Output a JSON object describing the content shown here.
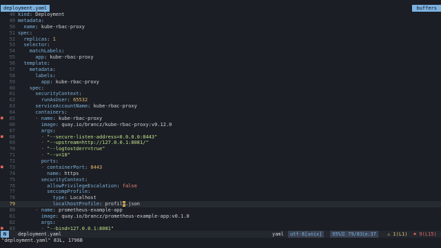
{
  "tabs": {
    "active": "deployment.yaml",
    "right_label": "buffers"
  },
  "lines": [
    {
      "n": "48",
      "sign": "",
      "segs": [
        [
          "k",
          "kind"
        ],
        [
          "v",
          ": Deployment"
        ]
      ]
    },
    {
      "n": "49",
      "sign": "",
      "segs": [
        [
          "k",
          "metadata"
        ],
        [
          "v",
          ":"
        ]
      ]
    },
    {
      "n": "50",
      "sign": "",
      "segs": [
        [
          "v",
          "  "
        ],
        [
          "k",
          "name"
        ],
        [
          "v",
          ": kube-rbac-proxy"
        ]
      ]
    },
    {
      "n": "51",
      "sign": "",
      "segs": [
        [
          "k",
          "spec"
        ],
        [
          "v",
          ":"
        ]
      ]
    },
    {
      "n": "52",
      "sign": "",
      "segs": [
        [
          "v",
          "  "
        ],
        [
          "k",
          "replicas"
        ],
        [
          "v",
          ": "
        ],
        [
          "n",
          "1"
        ]
      ]
    },
    {
      "n": "53",
      "sign": "",
      "segs": [
        [
          "v",
          "  "
        ],
        [
          "k",
          "selector"
        ],
        [
          "v",
          ":"
        ]
      ]
    },
    {
      "n": "54",
      "sign": "",
      "segs": [
        [
          "v",
          "    "
        ],
        [
          "k",
          "matchLabels"
        ],
        [
          "v",
          ":"
        ]
      ]
    },
    {
      "n": "55",
      "sign": "",
      "segs": [
        [
          "v",
          "      "
        ],
        [
          "k",
          "app"
        ],
        [
          "v",
          ": kube-rbac-proxy"
        ]
      ]
    },
    {
      "n": "56",
      "sign": "",
      "segs": [
        [
          "v",
          "  "
        ],
        [
          "k",
          "template"
        ],
        [
          "v",
          ":"
        ]
      ]
    },
    {
      "n": "57",
      "sign": "",
      "segs": [
        [
          "v",
          "    "
        ],
        [
          "k",
          "metadata"
        ],
        [
          "v",
          ":"
        ]
      ]
    },
    {
      "n": "58",
      "sign": "",
      "segs": [
        [
          "v",
          "      "
        ],
        [
          "k",
          "labels"
        ],
        [
          "v",
          ":"
        ]
      ]
    },
    {
      "n": "59",
      "sign": "",
      "segs": [
        [
          "v",
          "        "
        ],
        [
          "k",
          "app"
        ],
        [
          "v",
          ": kube-rbac-proxy"
        ]
      ]
    },
    {
      "n": "60",
      "sign": "",
      "segs": [
        [
          "v",
          "    "
        ],
        [
          "k",
          "spec"
        ],
        [
          "v",
          ":"
        ]
      ]
    },
    {
      "n": "61",
      "sign": "",
      "segs": [
        [
          "v",
          "      "
        ],
        [
          "k",
          "securityContext"
        ],
        [
          "v",
          ":"
        ]
      ]
    },
    {
      "n": "62",
      "sign": "",
      "segs": [
        [
          "v",
          "        "
        ],
        [
          "k",
          "runAsUser"
        ],
        [
          "v",
          ": "
        ],
        [
          "n",
          "65532"
        ]
      ]
    },
    {
      "n": "63",
      "sign": "",
      "segs": [
        [
          "v",
          "      "
        ],
        [
          "k",
          "serviceAccountName"
        ],
        [
          "v",
          ": kube-rbac-proxy"
        ]
      ]
    },
    {
      "n": "64",
      "sign": "",
      "segs": [
        [
          "v",
          "      "
        ],
        [
          "k",
          "containers"
        ],
        [
          "v",
          ":"
        ]
      ]
    },
    {
      "n": "65",
      "sign": "■",
      "segs": [
        [
          "v",
          "      "
        ],
        [
          "d",
          "- "
        ],
        [
          "k",
          "name"
        ],
        [
          "v",
          ": kube-rbac-proxy"
        ]
      ]
    },
    {
      "n": "66",
      "sign": "",
      "segs": [
        [
          "v",
          "        "
        ],
        [
          "k",
          "image"
        ],
        [
          "v",
          ": quay.io/brancz/kube-rbac-proxy:v0.12.0"
        ]
      ]
    },
    {
      "n": "67",
      "sign": "",
      "segs": [
        [
          "v",
          "        "
        ],
        [
          "k",
          "args"
        ],
        [
          "v",
          ":"
        ]
      ]
    },
    {
      "n": "68",
      "sign": "■",
      "segs": [
        [
          "v",
          "        "
        ],
        [
          "d",
          "- "
        ],
        [
          "s",
          "\"--secure-listen-address=0.0.0.0:8443\""
        ]
      ]
    },
    {
      "n": "69",
      "sign": "",
      "segs": [
        [
          "v",
          "        "
        ],
        [
          "d",
          "- "
        ],
        [
          "s",
          "\"--upstream=http://127.0.0.1:8081/\""
        ]
      ]
    },
    {
      "n": "70",
      "sign": "",
      "segs": [
        [
          "v",
          "        "
        ],
        [
          "d",
          "- "
        ],
        [
          "s",
          "\"--logtostderr=true\""
        ]
      ]
    },
    {
      "n": "71",
      "sign": "",
      "segs": [
        [
          "v",
          "        "
        ],
        [
          "d",
          "- "
        ],
        [
          "s",
          "\"--v=10\""
        ]
      ]
    },
    {
      "n": "72",
      "sign": "",
      "segs": [
        [
          "v",
          "        "
        ],
        [
          "k",
          "ports"
        ],
        [
          "v",
          ":"
        ]
      ]
    },
    {
      "n": "73",
      "sign": "■",
      "segs": [
        [
          "v",
          "        "
        ],
        [
          "d",
          "- "
        ],
        [
          "k",
          "containerPort"
        ],
        [
          "v",
          ": "
        ],
        [
          "n",
          "8443"
        ]
      ]
    },
    {
      "n": "74",
      "sign": "",
      "segs": [
        [
          "v",
          "          "
        ],
        [
          "k",
          "name"
        ],
        [
          "v",
          ": https"
        ]
      ]
    },
    {
      "n": "75",
      "sign": "",
      "segs": [
        [
          "v",
          "        "
        ],
        [
          "k",
          "securityContext"
        ],
        [
          "v",
          ":"
        ]
      ]
    },
    {
      "n": "76",
      "sign": "",
      "segs": [
        [
          "v",
          "          "
        ],
        [
          "k",
          "allowPrivilegeEscalation"
        ],
        [
          "v",
          ": "
        ],
        [
          "kw",
          "false"
        ]
      ]
    },
    {
      "n": "77",
      "sign": "",
      "segs": [
        [
          "v",
          "          "
        ],
        [
          "k",
          "seccompProfile"
        ],
        [
          "v",
          ":"
        ]
      ]
    },
    {
      "n": "78",
      "sign": "",
      "segs": [
        [
          "v",
          "            "
        ],
        [
          "k",
          "type"
        ],
        [
          "v",
          ": Localhost"
        ]
      ]
    },
    {
      "n": "79",
      "sign": "",
      "cur": true,
      "segs": [
        [
          "v",
          "            "
        ],
        [
          "k",
          "localhostProfile"
        ],
        [
          "v",
          ": profil"
        ],
        [
          "cursor",
          "e"
        ],
        [
          "v",
          ".json"
        ]
      ]
    },
    {
      "n": "80",
      "sign": "",
      "segs": [
        [
          "v",
          "      "
        ],
        [
          "d",
          "- "
        ],
        [
          "k",
          "name"
        ],
        [
          "v",
          ": prometheus-example-app"
        ]
      ]
    },
    {
      "n": "81",
      "sign": "",
      "segs": [
        [
          "v",
          "        "
        ],
        [
          "k",
          "image"
        ],
        [
          "v",
          ": quay.io/brancz/prometheus-example-app:v0.1.0"
        ]
      ]
    },
    {
      "n": "82",
      "sign": "",
      "segs": [
        [
          "v",
          "        "
        ],
        [
          "k",
          "args"
        ],
        [
          "v",
          ":"
        ]
      ]
    },
    {
      "n": "83",
      "sign": "■",
      "segs": [
        [
          "v",
          "        "
        ],
        [
          "d",
          "- "
        ],
        [
          "s",
          "\"--bind=127.0.0.1:8081\""
        ]
      ]
    }
  ],
  "status": {
    "mode": "N",
    "file": "deployment.yaml",
    "filetype": "yaml",
    "encoding": "utf-8[unix]",
    "position": "95%☰ 79/83㏑:37",
    "warnings": "⚠ 1(L1)",
    "errors": "✖ 9(L15)"
  },
  "cmdline": "\"deployment.yaml\" 83L, 1796B"
}
